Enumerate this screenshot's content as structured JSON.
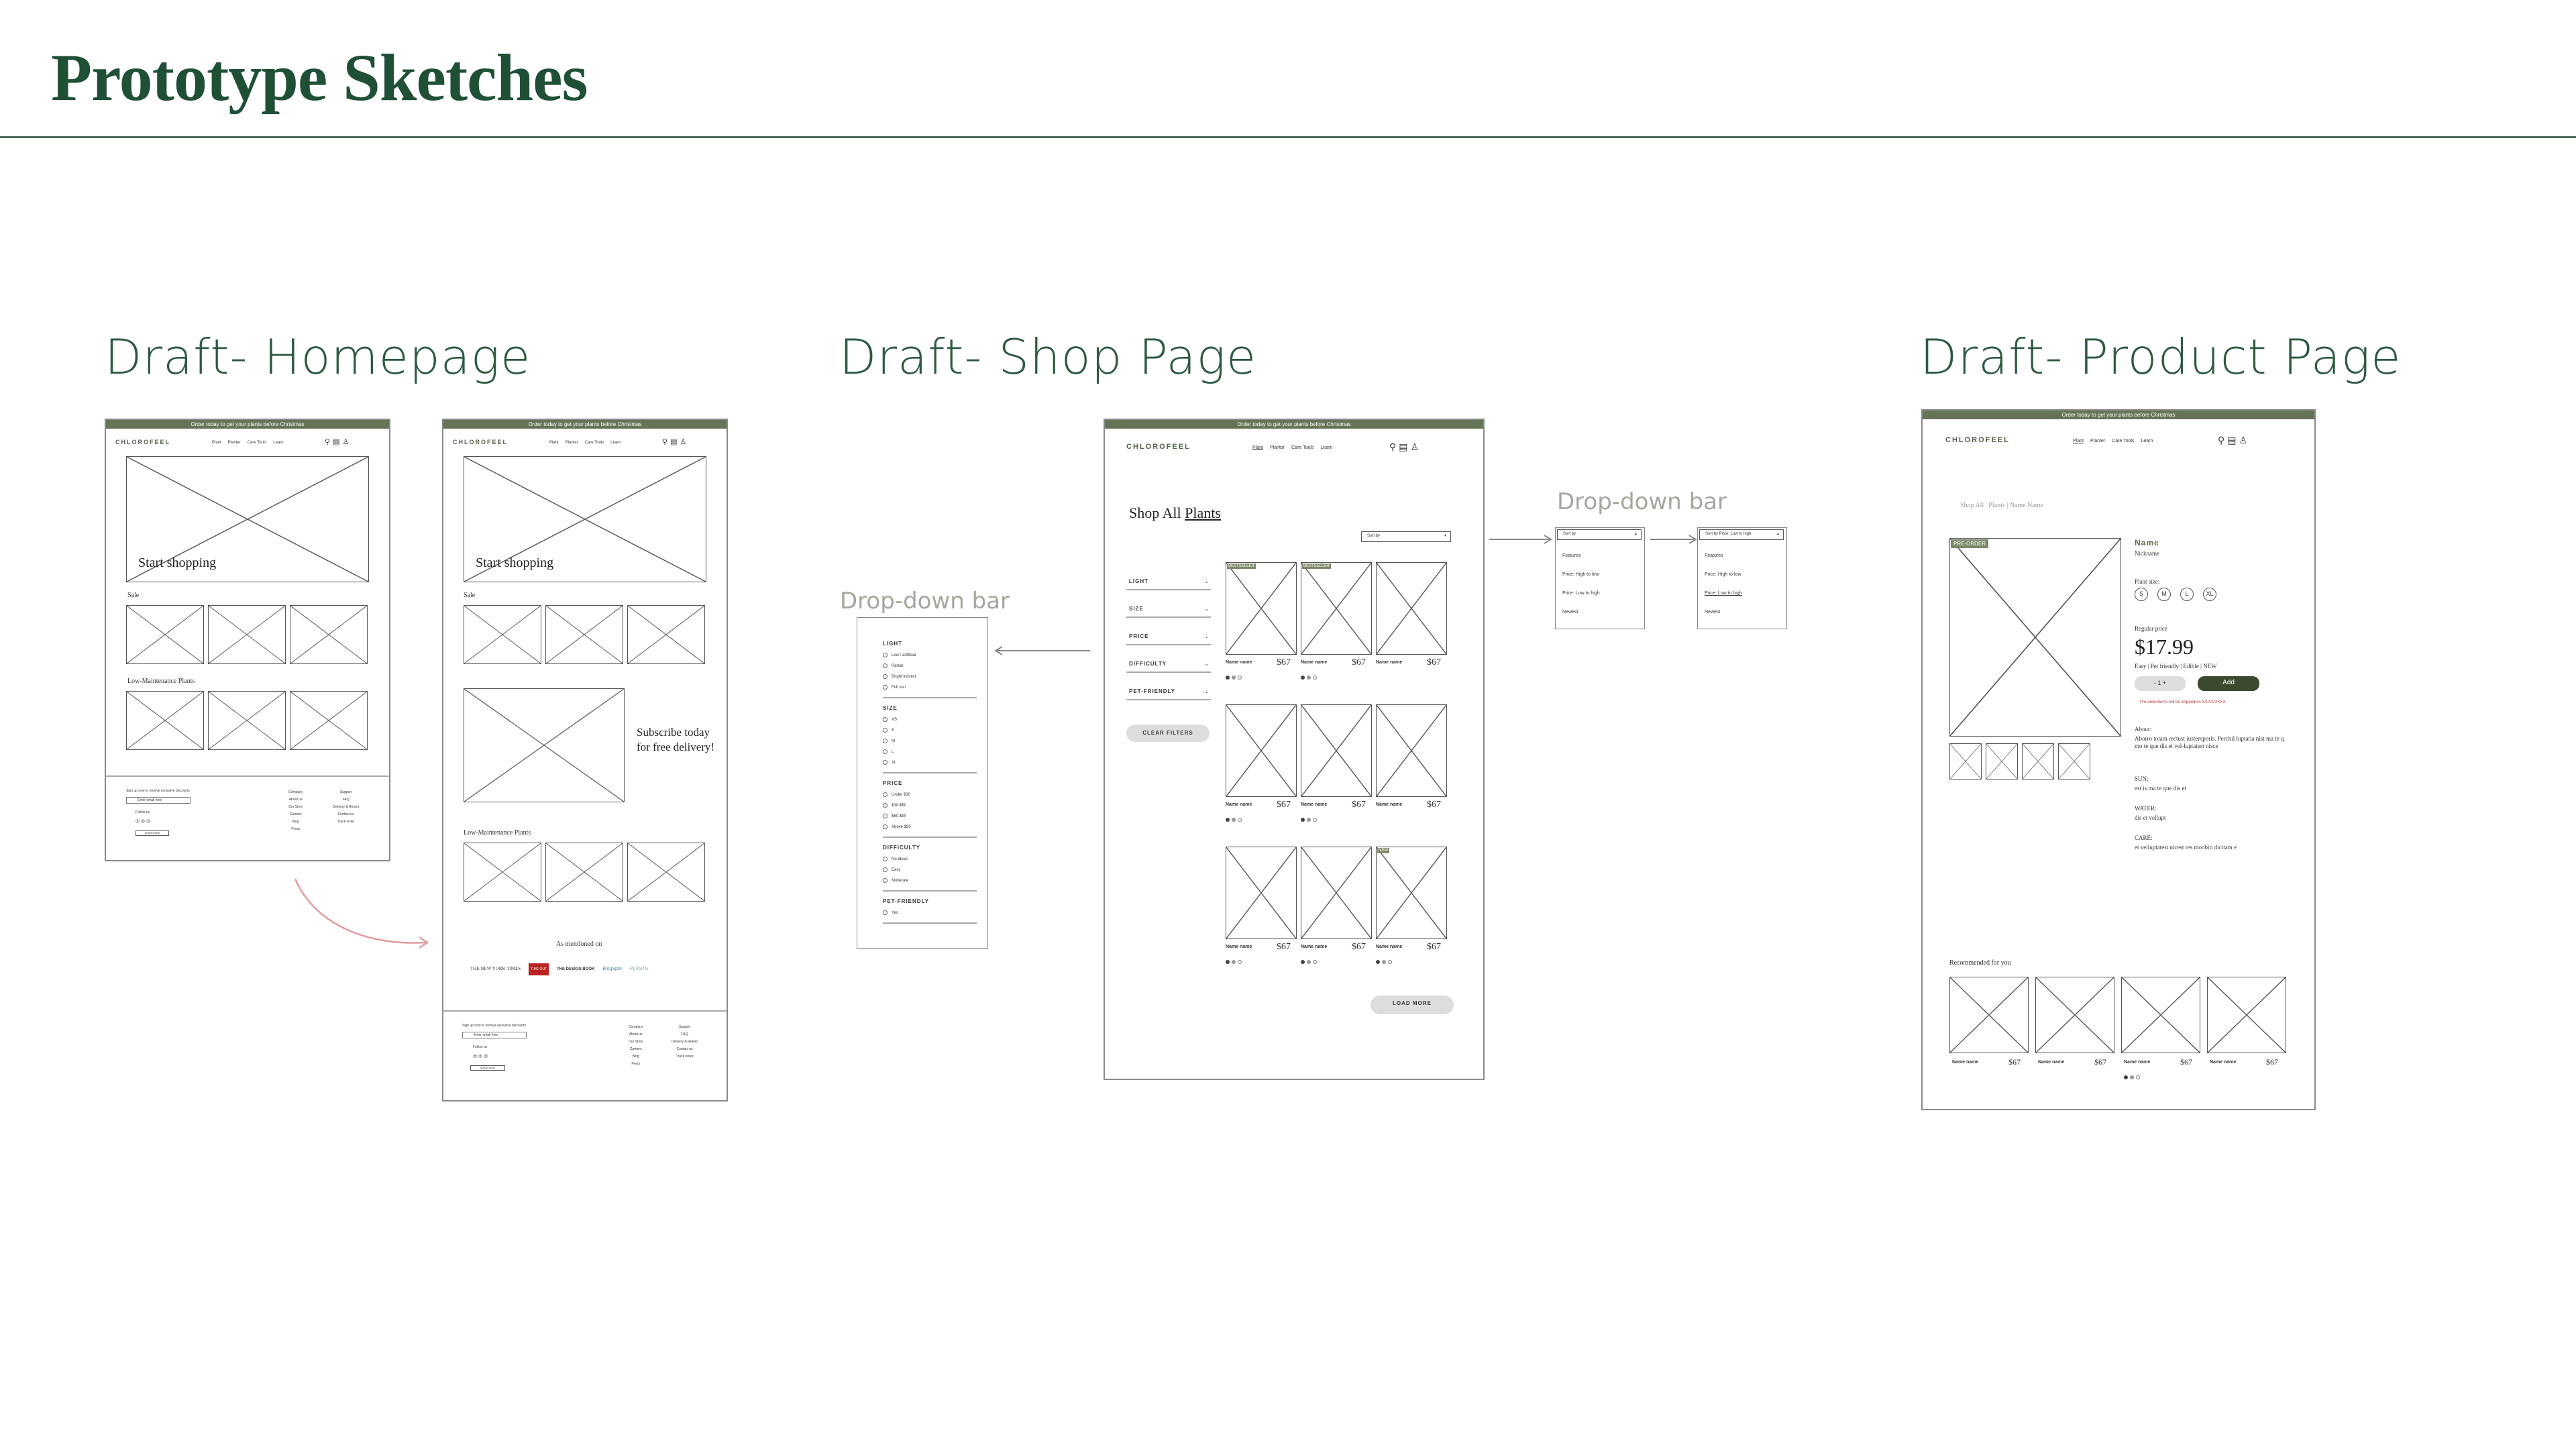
{
  "page": {
    "title": "Prototype Sketches"
  },
  "sections": {
    "homepage": "Draft- Homepage",
    "shop": "Draft- Shop Page",
    "product": "Draft- Product Page"
  },
  "labels": {
    "dropdown_left": "Drop-down bar",
    "dropdown_right": "Drop-down bar"
  },
  "site": {
    "banner": "Order today to get your plants before Christmas",
    "logo": "CHLOROFEEL",
    "nav": [
      "Plant",
      "Planter",
      "Care Tools",
      "Learn"
    ],
    "header_icons": [
      "search-icon",
      "cart-icon",
      "account-icon"
    ]
  },
  "home": {
    "hero_cta": "Start shopping",
    "sale": "Sale",
    "low_maintenance": "Low-Maintenance Plants",
    "subscribe": "Subscribe today for free delivery!",
    "mentioned": "As mentioned on",
    "press": [
      "THE NEW YORK TIMES",
      "TIME OUT",
      "THE DESIGN BOOK",
      "BlogSpot",
      "PLANTS"
    ],
    "footer_signup": "Sign up now to receive exclusive discounts",
    "footer_email": "Enter email here",
    "footer_follow": "Follow us",
    "footer_subscribe": "SUBSCRIBE",
    "footer_col1": [
      "Company",
      "About us",
      "Our Story",
      "Careers",
      "Blog",
      "Press"
    ],
    "footer_col2": [
      "Support",
      "FAQ",
      "Delivery & Return",
      "Contact us",
      "Track order"
    ]
  },
  "shop": {
    "heading_prefix": "Shop All",
    "heading_link": "Plants",
    "sort": "Sort by",
    "filters": [
      "LIGHT",
      "SIZE",
      "PRICE",
      "DIFFICULTY",
      "PET-FRIENDLY"
    ],
    "clear_filters": "CLEAR FILTERS",
    "product_name": "Name name",
    "product_price": "$67",
    "load_more": "LOAD MORE",
    "badges": [
      "BESTSELLER",
      "BESTSELLER",
      "NEW"
    ]
  },
  "dropdown_filters": {
    "groups": [
      {
        "name": "LIGHT",
        "options": [
          "Low / artificial",
          "Partial",
          "Bright indirect",
          "Full sun"
        ]
      },
      {
        "name": "SIZE",
        "options": [
          "XS",
          "S",
          "M",
          "L",
          "XL"
        ]
      },
      {
        "name": "PRICE",
        "options": [
          "Under $30",
          "$30-$60",
          "$60-$90",
          "Above $90"
        ]
      },
      {
        "name": "DIFFICULTY",
        "options": [
          "No-ideas",
          "Easy",
          "Moderate"
        ]
      },
      {
        "name": "PET-FRIENDLY",
        "options": [
          "Yes"
        ]
      }
    ]
  },
  "sort_dropdown": {
    "closed": "Sort by",
    "open": "Sort by Price: Low to high",
    "options": [
      "Features",
      "Price: High to low",
      "Price: Low to high",
      "Newest"
    ]
  },
  "product": {
    "breadcrumb": "Shop All | Plants | Name Name",
    "name": "Name",
    "nickname": "Nickname",
    "badge": "PRE-ORDER",
    "plant_size_label": "Plant size:",
    "sizes": [
      "S",
      "M",
      "L",
      "XL"
    ],
    "regular_price_label": "Regular price",
    "price": "$17.99",
    "tags": "Easy | Pet friendly | Edible | NEW",
    "qty": "-   1   +",
    "add": "Add",
    "shipping_note": "Pre-order items will be shipped on XX/XX/XXXX",
    "about_label": "About:",
    "about_text": "Aborro totam rectust iustemporis. Perchil luptatia nist ma te q mo te que dis et vel-luptatest nisce",
    "sun_label": "SUN:",
    "sun_text": "est is ma te que dis et",
    "water_label": "WATER:",
    "water_text": "dis et vellupt",
    "care_label": "CARE:",
    "care_text": "et velluptatest nicest res moobiti dicitam e",
    "recommended": "Recommended for you",
    "rec_name": "Name name",
    "rec_price": "$67"
  },
  "colors": {
    "heading": "#1f5035",
    "banner": "#667456",
    "accent_arrow": "#e39aa0"
  }
}
